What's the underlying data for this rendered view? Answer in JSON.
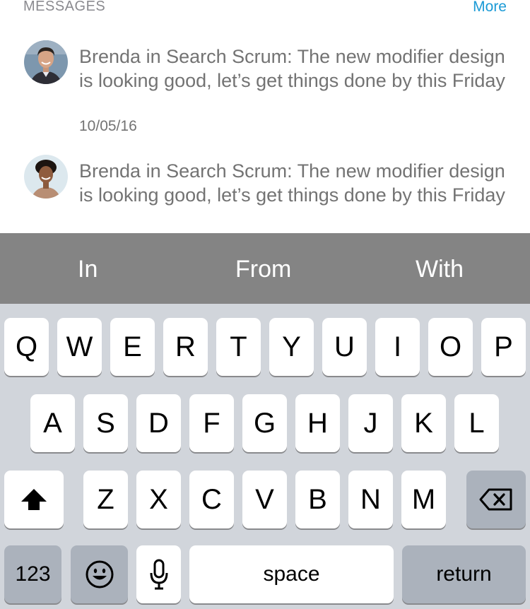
{
  "messages": {
    "section_title": "MESSAGES",
    "more_label": "More",
    "items": [
      {
        "avatar": "man-avatar",
        "text": "Brenda in Search Scrum: The new modifier design is looking good, let’s get things done by this Friday",
        "date": "10/05/16"
      },
      {
        "avatar": "woman-avatar",
        "text": "Brenda in Search Scrum: The new modifier design is looking good, let’s get things done by this Friday",
        "date": ""
      }
    ]
  },
  "suggestions": [
    "In",
    "From",
    "With"
  ],
  "keyboard": {
    "row1": [
      "Q",
      "W",
      "E",
      "R",
      "T",
      "Y",
      "U",
      "I",
      "O",
      "P"
    ],
    "row2": [
      "A",
      "S",
      "D",
      "F",
      "G",
      "H",
      "J",
      "K",
      "L"
    ],
    "row3": [
      "Z",
      "X",
      "C",
      "V",
      "B",
      "N",
      "M"
    ],
    "numbers_label": "123",
    "space_label": "space",
    "return_label": "return",
    "shift_icon": "shift-icon",
    "delete_icon": "backspace-icon",
    "emoji_icon": "emoji-icon",
    "mic_icon": "microphone-icon"
  },
  "colors": {
    "accent": "#1a9ad6",
    "suggestion_bar": "#848484",
    "keyboard_bg": "#d1d5db",
    "key_dark": "#abb2bc"
  }
}
